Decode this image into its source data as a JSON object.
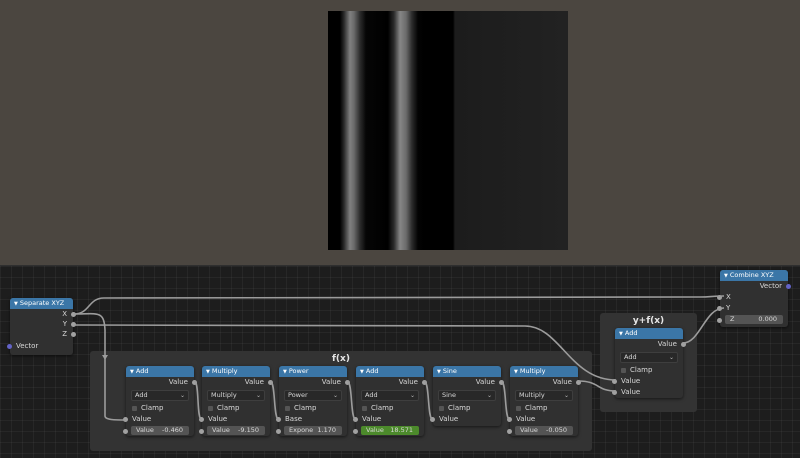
{
  "frame_title": "f(x)",
  "frame2_title": "y+f(x)",
  "colors": {
    "node_header": "#3b76a7",
    "value_socket": "#a1a1a1",
    "vector_socket": "#6363c7",
    "highlight_field": "#4c8a2b"
  },
  "separate": {
    "title": "Separate XYZ",
    "out_x": "X",
    "out_y": "Y",
    "out_z": "Z",
    "in_vector": "Vector"
  },
  "combine": {
    "title": "Combine XYZ",
    "out_vector": "Vector",
    "in_x": "X",
    "in_y": "Y",
    "z_label": "Z",
    "z_value": "0.000"
  },
  "nodes": [
    {
      "title": "Add",
      "out": "Value",
      "op": "Add",
      "clamp": "Clamp",
      "in1": "Value",
      "field_label": "Value",
      "field_value": "-0.460"
    },
    {
      "title": "Multiply",
      "out": "Value",
      "op": "Multiply",
      "clamp": "Clamp",
      "in1": "Value",
      "field_label": "Value",
      "field_value": "-9.150"
    },
    {
      "title": "Power",
      "out": "Value",
      "op": "Power",
      "clamp": "Clamp",
      "in1": "Base",
      "field_label": "Expone",
      "field_value": "1.170"
    },
    {
      "title": "Add",
      "out": "Value",
      "op": "Add",
      "clamp": "Clamp",
      "in1": "Value",
      "field_label": "Value",
      "field_value": "18.571"
    },
    {
      "title": "Sine",
      "out": "Value",
      "op": "Sine",
      "clamp": "Clamp",
      "in1": "Value"
    },
    {
      "title": "Multiply",
      "out": "Value",
      "op": "Multiply",
      "clamp": "Clamp",
      "in1": "Value",
      "field_label": "Value",
      "field_value": "-0.050"
    }
  ],
  "add_final": {
    "title": "Add",
    "out": "Value",
    "op": "Add",
    "clamp": "Clamp",
    "in1": "Value",
    "in2": "Value"
  }
}
